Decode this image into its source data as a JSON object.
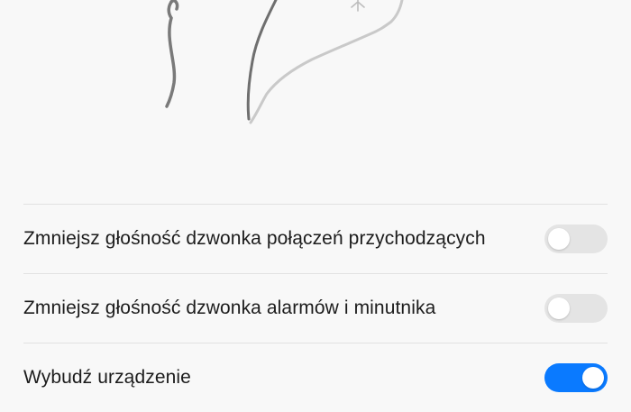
{
  "settings": {
    "items": [
      {
        "label": "Zmniejsz głośność dzwonka połączeń przychodzących",
        "enabled": false
      },
      {
        "label": "Zmniejsz głośność dzwonka alarmów i minutnika",
        "enabled": false
      },
      {
        "label": "Wybudź urządzenie",
        "enabled": true
      }
    ]
  },
  "colors": {
    "toggle_on": "#0a7aff",
    "toggle_off": "#e4e4e4",
    "divider": "#e2e2e2",
    "background": "#f8f8f8"
  },
  "icons": {
    "illustration": "hand-gesture-illustration"
  }
}
